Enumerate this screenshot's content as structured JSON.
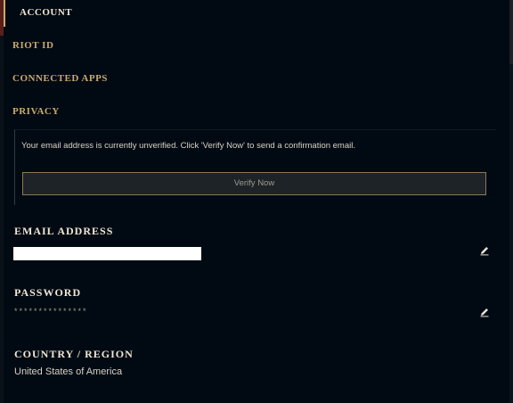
{
  "nav": {
    "account": "ACCOUNT",
    "riot_id": "RIOT ID",
    "connected_apps": "CONNECTED APPS",
    "privacy": "PRIVACY"
  },
  "notice": {
    "message": "Your email address is currently unverified. Click 'Verify Now' to send a confirmation email.",
    "verify_label": "Verify Now"
  },
  "email": {
    "title": "EMAIL ADDRESS",
    "value": ""
  },
  "password": {
    "title": "PASSWORD",
    "value": "***************"
  },
  "country": {
    "title": "COUNTRY / REGION",
    "value": "United States of America"
  },
  "icons": {
    "edit": "pencil-icon"
  },
  "colors": {
    "background": "#010a13",
    "gold": "#c8aa6e",
    "text_light": "#f0e6d2",
    "button_border": "#8c7a52",
    "button_bg": "#1e2328"
  }
}
